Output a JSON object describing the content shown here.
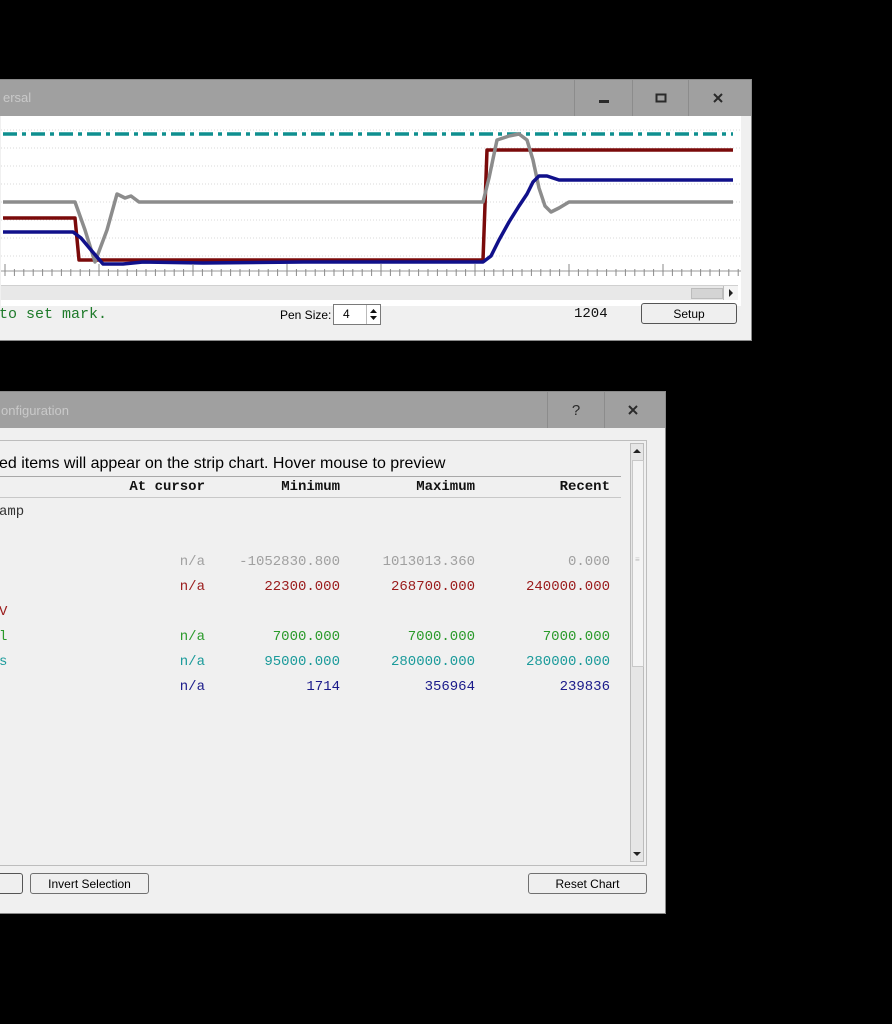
{
  "strip_window": {
    "title": "ersal",
    "status_text": "to set mark.",
    "pen_size_label": "Pen Size:",
    "pen_size_value": "4",
    "cursor_value": "1204",
    "setup_label": "Setup"
  },
  "chart_data": {
    "type": "line",
    "title": "",
    "xlabel": "",
    "ylabel": "",
    "grid": true,
    "series": [
      {
        "color": "#0f8f8f",
        "style": "dash-dot",
        "x": [
          0,
          730
        ],
        "y": [
          134,
          134
        ]
      },
      {
        "color": "#7a0a0a",
        "style": "solid",
        "x": [
          0,
          72,
          76,
          480,
          484,
          730
        ],
        "y": [
          218,
          218,
          260,
          260,
          150,
          150
        ]
      },
      {
        "color": "#8c8c8c",
        "style": "solid",
        "x": [
          0,
          72,
          82,
          92,
          104,
          114,
          122,
          128,
          136,
          480,
          486,
          494,
          506,
          516,
          524,
          530,
          536,
          542,
          548,
          556,
          566,
          576,
          730
        ],
        "y": [
          202,
          202,
          230,
          262,
          230,
          194,
          198,
          196,
          202,
          202,
          178,
          140,
          136,
          134,
          140,
          160,
          188,
          206,
          212,
          208,
          202,
          202,
          202
        ]
      },
      {
        "color": "#10108a",
        "style": "solid",
        "x": [
          0,
          70,
          78,
          88,
          100,
          120,
          140,
          200,
          300,
          480,
          488,
          496,
          506,
          516,
          524,
          530,
          536,
          544,
          556,
          730
        ],
        "y": [
          232,
          232,
          238,
          250,
          264,
          264,
          262,
          263,
          262,
          262,
          256,
          240,
          222,
          206,
          194,
          182,
          176,
          176,
          180,
          180
        ]
      }
    ]
  },
  "config_window": {
    "title": "onfiguration",
    "help_label": "?",
    "heading": "ed items will appear on the strip chart.   Hover mouse to preview",
    "columns": [
      "At cursor",
      "Minimum",
      "Maximum",
      "Recent"
    ],
    "group_label": "amp",
    "rows": [
      {
        "name": "",
        "color": "#a0a0a0",
        "values": [
          "n/a",
          "-1052830.800",
          "1013013.360",
          "0.000"
        ]
      },
      {
        "name": "",
        "color": "#9a1a1a",
        "values": [
          "n/a",
          "22300.000",
          "268700.000",
          "240000.000"
        ]
      },
      {
        "name": "V",
        "color": "#9a1a1a",
        "values": [
          "",
          "",
          "",
          ""
        ]
      },
      {
        "name": "l",
        "color": "#2a9a2a",
        "values": [
          "n/a",
          "7000.000",
          "7000.000",
          "7000.000"
        ]
      },
      {
        "name": "s",
        "color": "#1a9a9a",
        "values": [
          "n/a",
          "95000.000",
          "280000.000",
          "280000.000"
        ]
      },
      {
        "name": "",
        "color": "#1a1a8a",
        "values": [
          "n/a",
          "1714",
          "356964",
          "239836"
        ]
      }
    ],
    "invert_label": "Invert Selection",
    "reset_label": "Reset Chart"
  }
}
